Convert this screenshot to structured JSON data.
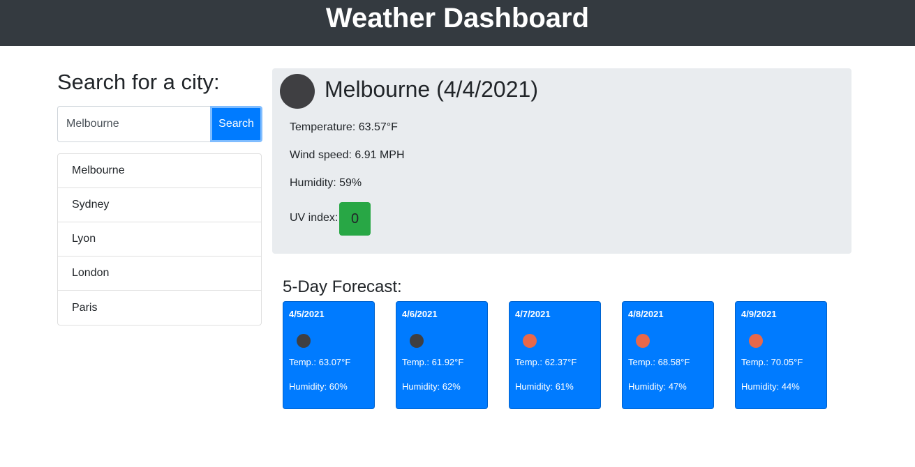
{
  "header": {
    "title": "Weather Dashboard"
  },
  "search": {
    "heading": "Search for a city:",
    "input_value": "Melbourne",
    "button_label": "Search"
  },
  "history": [
    "Melbourne",
    "Sydney",
    "Lyon",
    "London",
    "Paris"
  ],
  "current": {
    "title": "Melbourne (4/4/2021)",
    "temperature": "Temperature: 63.57°F",
    "wind": "Wind speed: 6.91 MPH",
    "humidity": "Humidity: 59%",
    "uv_label": "UV index:",
    "uv_value": "0",
    "icon": "cloud-icon",
    "uv_color": "#28a745"
  },
  "forecast": {
    "heading": "5-Day Forecast:",
    "days": [
      {
        "date": "4/5/2021",
        "temp": "Temp.: 63.07°F",
        "humidity": "Humidity: 60%",
        "icon": "cloud-icon",
        "icon_color": "#3f3f42"
      },
      {
        "date": "4/6/2021",
        "temp": "Temp.: 61.92°F",
        "humidity": "Humidity: 62%",
        "icon": "cloud-icon",
        "icon_color": "#3f3f42"
      },
      {
        "date": "4/7/2021",
        "temp": "Temp.: 62.37°F",
        "humidity": "Humidity: 61%",
        "icon": "sun-icon",
        "icon_color": "#e8684a"
      },
      {
        "date": "4/8/2021",
        "temp": "Temp.: 68.58°F",
        "humidity": "Humidity: 47%",
        "icon": "sun-icon",
        "icon_color": "#e8684a"
      },
      {
        "date": "4/9/2021",
        "temp": "Temp.: 70.05°F",
        "humidity": "Humidity: 44%",
        "icon": "sun-icon",
        "icon_color": "#e8684a"
      }
    ]
  },
  "colors": {
    "header_bg": "#343a40",
    "primary": "#007bff",
    "card_bg": "#e9ecef"
  }
}
